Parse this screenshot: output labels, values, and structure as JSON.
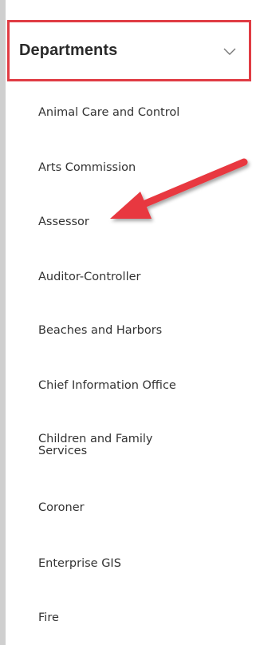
{
  "departments": {
    "title": "Departments",
    "chevron_icon": "chevron-down-icon",
    "items": [
      {
        "label": "Animal Care and Control"
      },
      {
        "label": "Arts Commission"
      },
      {
        "label": "Assessor"
      },
      {
        "label": "Auditor-Controller"
      },
      {
        "label": "Beaches and Harbors"
      },
      {
        "label": "Chief Information Office"
      },
      {
        "label": "Children and Family Services"
      },
      {
        "label": "Coroner"
      },
      {
        "label": "Enterprise GIS"
      },
      {
        "label": "Fire"
      }
    ]
  },
  "annotation": {
    "arrow_icon": "red-pointer-arrow",
    "color": "#e8373f"
  },
  "colors": {
    "highlight_border": "#e03c44",
    "rail": "#cfcfcf",
    "text": "#333333"
  }
}
